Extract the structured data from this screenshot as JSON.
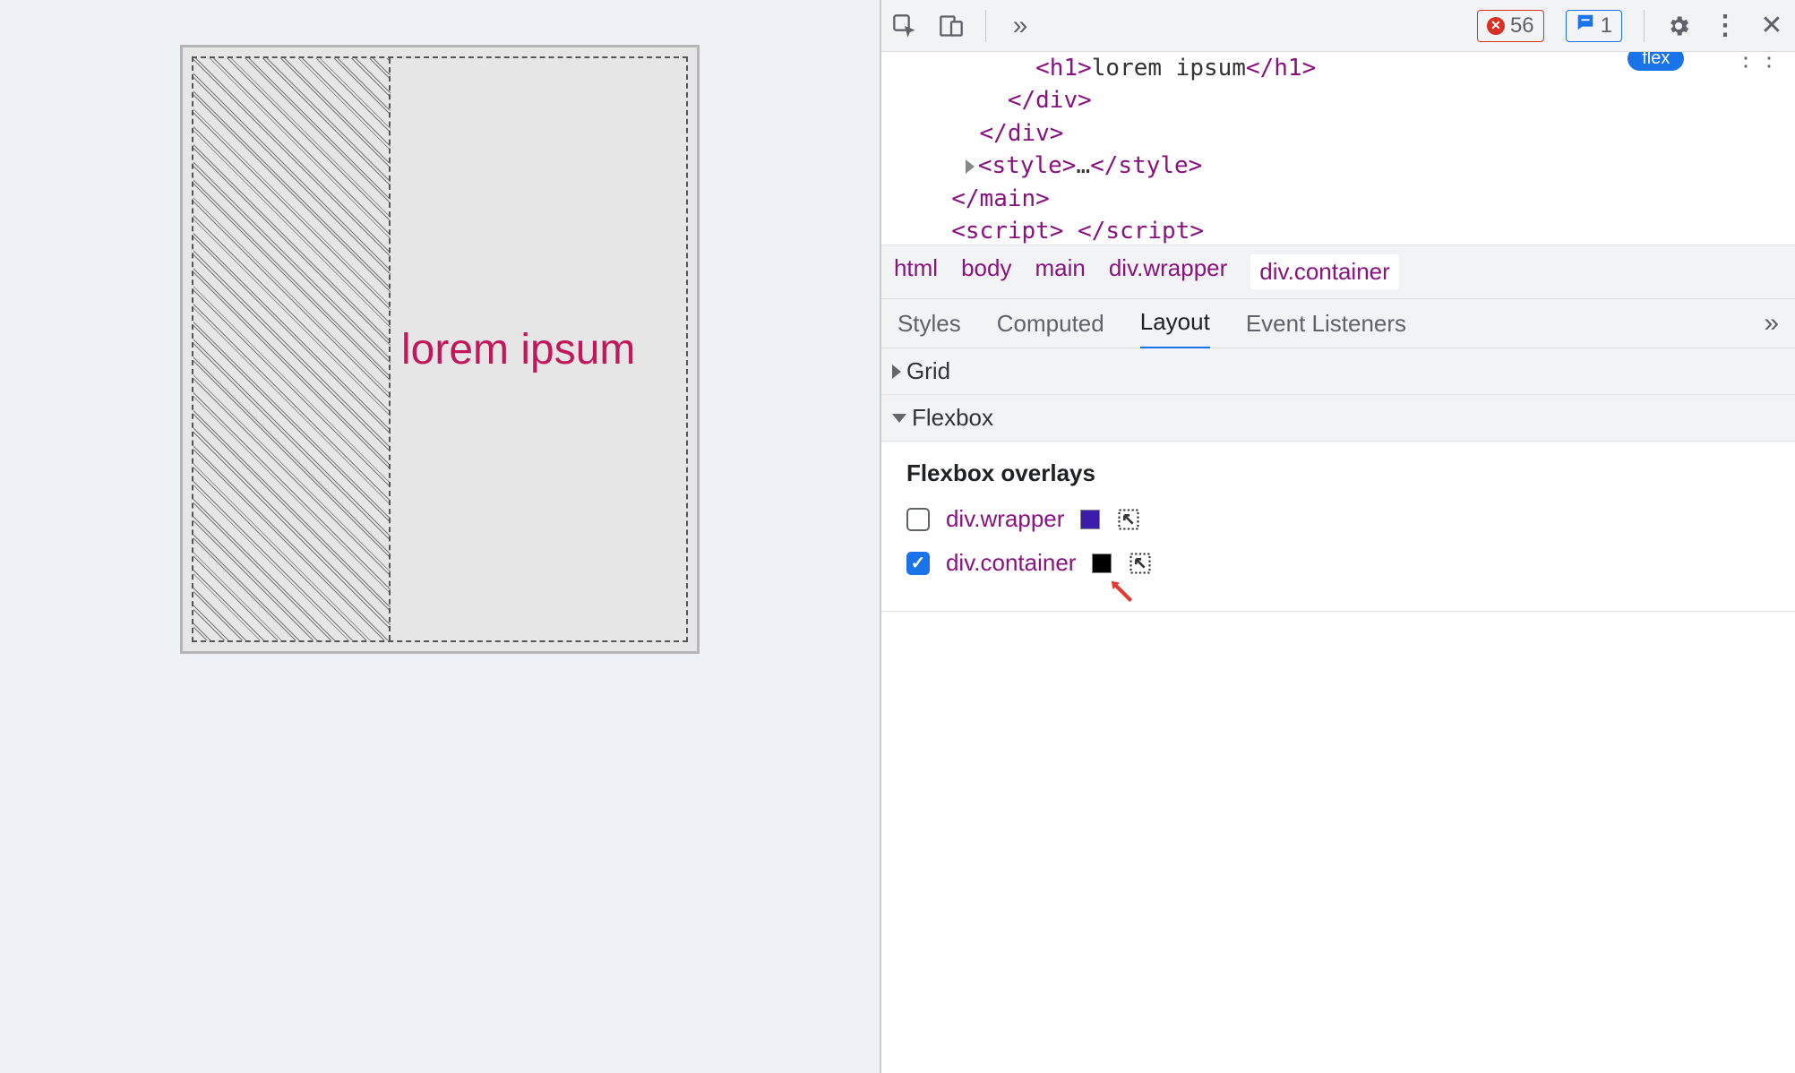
{
  "viewport": {
    "flex_text": "lorem ipsum"
  },
  "toolbar": {
    "overflow_glyph": "»",
    "error_count": "56",
    "message_count": "1"
  },
  "elements": {
    "line1_pre": "           ",
    "line1_open": "<h1>",
    "line1_text": "lorem ipsum",
    "line1_close": "</h1>",
    "line2_pre": "         ",
    "line2": "</div>",
    "line3_pre": "       ",
    "line3": "</div>",
    "line4_pre": "      ",
    "line4_open": "<style>",
    "line4_ell": "…",
    "line4_close": "</style>",
    "line5_pre": "     ",
    "line5": "</main>",
    "line6_pre": "     ",
    "line6_open": "<script>",
    "line6_sp": " ",
    "line6_close": "</script>"
  },
  "breadcrumb": {
    "html": "html",
    "body": "body",
    "main": "main",
    "wrapper": "div.wrapper",
    "container": "div.container"
  },
  "subtabs": {
    "styles": "Styles",
    "computed": "Computed",
    "layout": "Layout",
    "event_listeners": "Event Listeners",
    "more": "»"
  },
  "sections": {
    "grid": "Grid",
    "flexbox": "Flexbox"
  },
  "overlays": {
    "title": "Flexbox overlays",
    "wrapper_label": "div.wrapper",
    "container_label": "div.container"
  }
}
